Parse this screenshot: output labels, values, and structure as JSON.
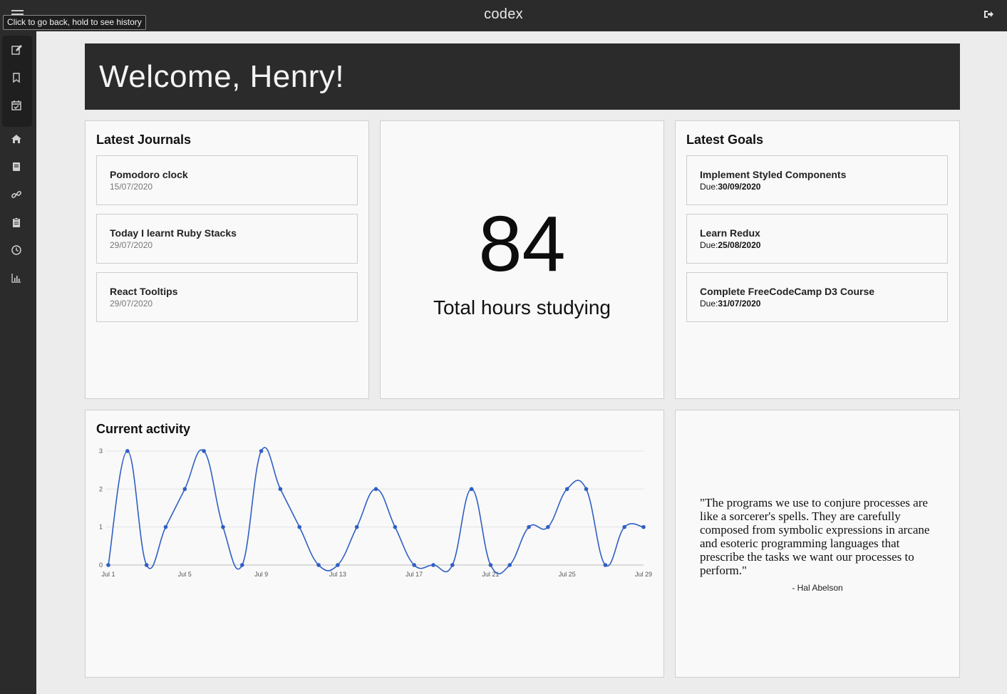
{
  "app": {
    "brand": "codex"
  },
  "tooltip": "Click to go back, hold to see history",
  "icons": {
    "menu": "hamburger-icon",
    "logout": "logout-icon",
    "sidebar": [
      "edit-icon",
      "bookmark-icon",
      "calendar-check-icon",
      "home-icon",
      "book-icon",
      "link-icon",
      "clipboard-icon",
      "clock-icon",
      "bar-chart-icon"
    ]
  },
  "welcome": "Welcome, Henry!",
  "journals": {
    "title": "Latest Journals",
    "items": [
      {
        "title": "Pomodoro clock",
        "date": "15/07/2020"
      },
      {
        "title": "Today I learnt Ruby Stacks",
        "date": "29/07/2020"
      },
      {
        "title": "React Tooltips",
        "date": "29/07/2020"
      }
    ]
  },
  "stats": {
    "hours": "84",
    "label": "Total hours studying"
  },
  "goals": {
    "title": "Latest Goals",
    "due_prefix": "Due:",
    "items": [
      {
        "title": "Implement Styled Components",
        "due": "30/09/2020"
      },
      {
        "title": "Learn Redux",
        "due": "25/08/2020"
      },
      {
        "title": "Complete FreeCodeCamp D3 Course",
        "due": "31/07/2020"
      }
    ]
  },
  "activity": {
    "title": "Current activity"
  },
  "quote": {
    "text": "\"The programs we use to conjure processes are like a sorcerer's spells. They are carefully composed from symbolic expressions in arcane and esoteric programming languages that prescribe the tasks we want our processes to perform.\"",
    "author": "- Hal Abelson"
  },
  "colors": {
    "line": "#2f5fc4",
    "dark": "#2b2b2b"
  },
  "chart_data": {
    "type": "line",
    "x": [
      "Jul 1",
      "Jul 2",
      "Jul 3",
      "Jul 4",
      "Jul 5",
      "Jul 6",
      "Jul 7",
      "Jul 8",
      "Jul 9",
      "Jul 10",
      "Jul 11",
      "Jul 12",
      "Jul 13",
      "Jul 14",
      "Jul 15",
      "Jul 16",
      "Jul 17",
      "Jul 18",
      "Jul 19",
      "Jul 20",
      "Jul 21",
      "Jul 22",
      "Jul 23",
      "Jul 24",
      "Jul 25",
      "Jul 26",
      "Jul 27",
      "Jul 28",
      "Jul 29"
    ],
    "values": [
      0,
      3,
      0,
      1,
      2,
      3,
      1,
      0,
      3,
      2,
      1,
      0,
      0,
      1,
      2,
      1,
      0,
      0,
      0,
      2,
      0,
      0,
      1,
      1,
      2,
      2,
      0,
      1,
      1
    ],
    "x_ticks": [
      "Jul 1",
      "Jul 5",
      "Jul 9",
      "Jul 13",
      "Jul 17",
      "Jul 21",
      "Jul 25",
      "Jul 29"
    ],
    "y_ticks": [
      0,
      1,
      2,
      3
    ],
    "ylim": [
      0,
      3
    ],
    "grid": true,
    "curve": "smooth"
  }
}
